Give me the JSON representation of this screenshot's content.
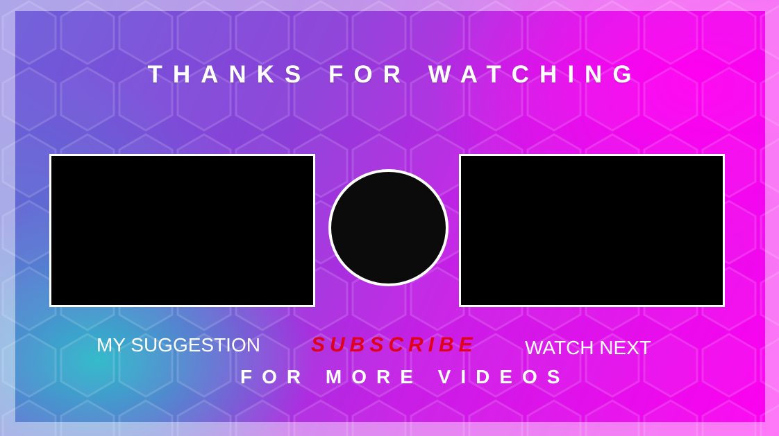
{
  "colors": {
    "accent_magenta": "#ff00f0",
    "accent_cyan": "#28bec8",
    "subscribe_red": "#e0001a",
    "frame_white": "#ffffff",
    "screen_black": "#000000"
  },
  "end_screen": {
    "title": "THANKS FOR WATCHING",
    "left_label": "MY SUGGESTION",
    "subscribe_label": "SUBSCRIBE",
    "right_label": "WATCH NEXT",
    "tagline": "FOR MORE VIDEOS"
  }
}
